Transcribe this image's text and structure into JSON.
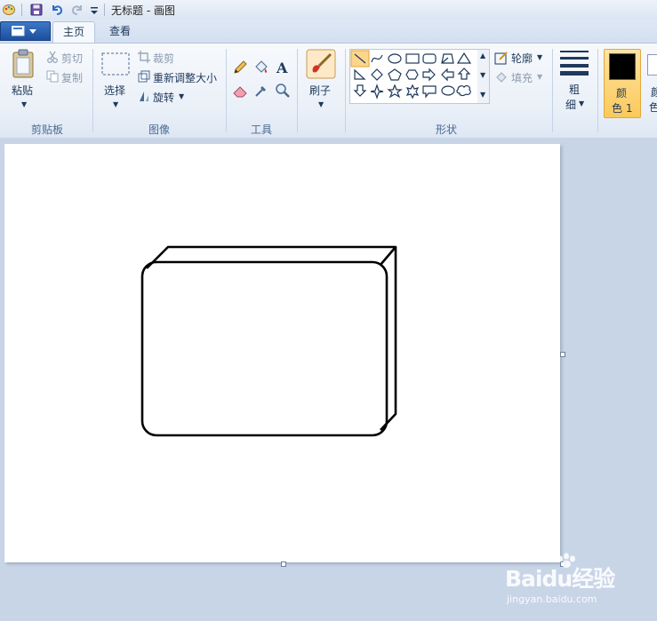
{
  "window": {
    "title": "无标题 - 画图"
  },
  "tabs": [
    {
      "label": "主页",
      "active": true
    },
    {
      "label": "查看",
      "active": false
    }
  ],
  "clipboard": {
    "paste_label": "粘贴",
    "cut_label": "剪切",
    "copy_label": "复制",
    "group_label": "剪贴板"
  },
  "image": {
    "select_label": "选择",
    "crop_label": "裁剪",
    "resize_label": "重新调整大小",
    "rotate_label": "旋转",
    "group_label": "图像"
  },
  "tools": {
    "group_label": "工具",
    "brush_label": "刷子"
  },
  "shapes": {
    "outline_label": "轮廓",
    "fill_label": "填充",
    "group_label": "形状"
  },
  "size": {
    "label_line1": "粗",
    "label_line2": "细"
  },
  "colors": {
    "color1_line1": "颜",
    "color1_line2": "色 1",
    "color2_partial": "颜",
    "color2_partial2": "色",
    "color1_value": "#000000"
  },
  "watermark": {
    "brand": "Baidu经验",
    "url": "jingyan.baidu.com"
  },
  "theme": {
    "accent": "#1d4f9c",
    "canvas": "#ffffff",
    "workspace": "#c8d5e7"
  }
}
